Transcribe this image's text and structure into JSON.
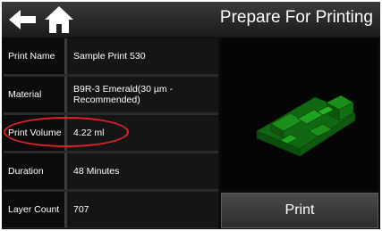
{
  "header": {
    "title": "Prepare For Printing",
    "back_icon": "arrow-left-icon",
    "home_icon": "home-icon"
  },
  "print_info": {
    "rows": [
      {
        "label": "Print Name",
        "value": "Sample Print 530"
      },
      {
        "label": "Material",
        "value": "B9R-3 Emerald(30 µm - Recommended)"
      },
      {
        "label": "Print Volume",
        "value": "4.22 ml"
      },
      {
        "label": "Duration",
        "value": "48 Minutes"
      },
      {
        "label": "Layer Count",
        "value": "707"
      }
    ],
    "highlight_color": "#e0202a"
  },
  "preview": {
    "model_color": "#1a8f1a"
  },
  "actions": {
    "print_label": "Print"
  }
}
